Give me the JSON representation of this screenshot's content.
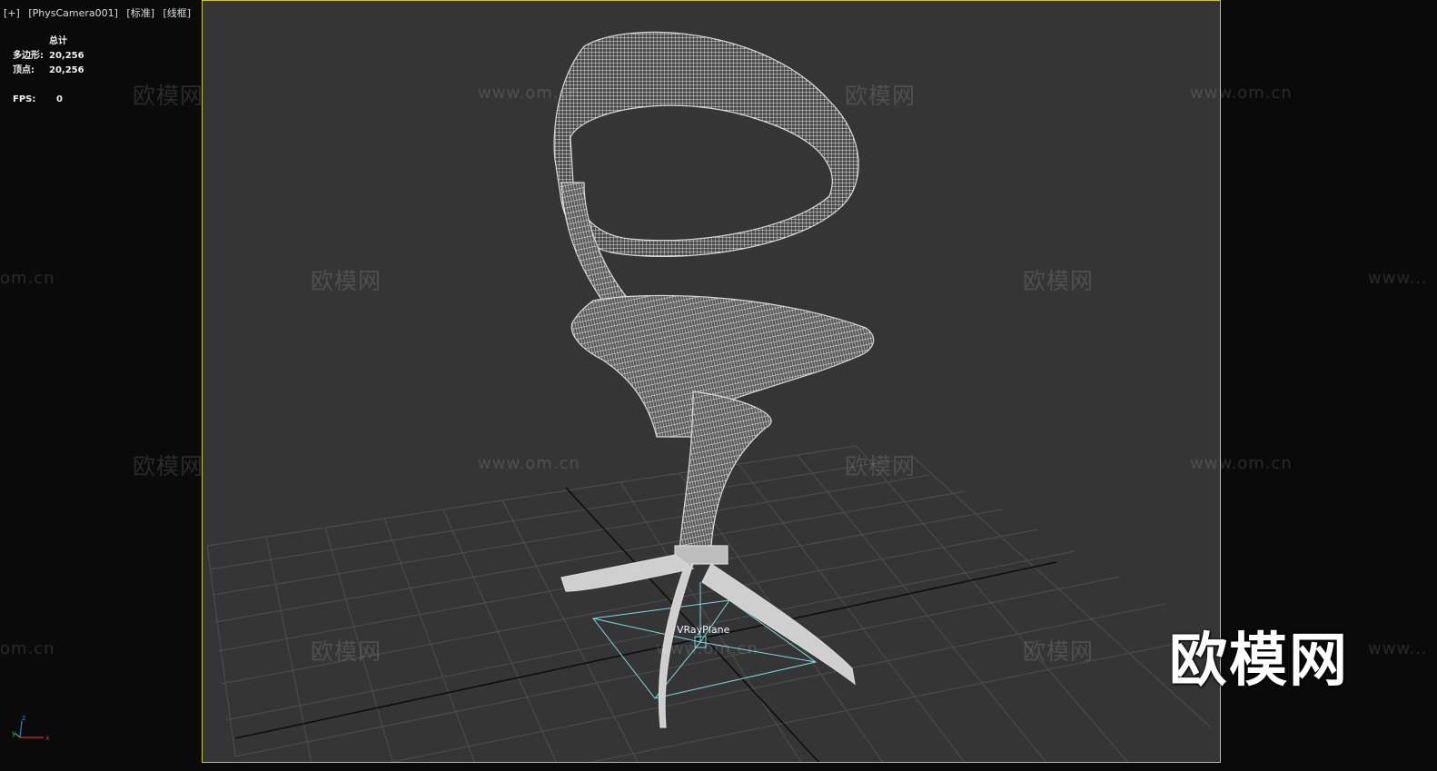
{
  "viewport": {
    "menu": "[+]",
    "camera": "[PhysCamera001]",
    "shading_mode": "[标准]",
    "display_mode": "[线框]"
  },
  "stats": {
    "header": "总计",
    "polygons_label": "多边形:",
    "polygons_value": "20,256",
    "vertices_label": "顶点:",
    "vertices_value": "20,256",
    "fps_label": "FPS:",
    "fps_value": "0"
  },
  "scene": {
    "object_label": "VRayPlane",
    "wire_color": "#dcdcdc",
    "light_color": "#7fd8e0",
    "grid_color": "#4f4f4f",
    "bg_color": "#353535"
  },
  "watermarks": {
    "cn_text": "欧模网",
    "url_text": "www.om.cn",
    "url_partial_left": "om.cn",
    "url_partial_right": "www...",
    "brand": "欧模网"
  },
  "gizmo": {
    "x_label": "x",
    "y_label": "y",
    "z_label": "z"
  },
  "icons": [
    "axis-gizmo-icon"
  ]
}
